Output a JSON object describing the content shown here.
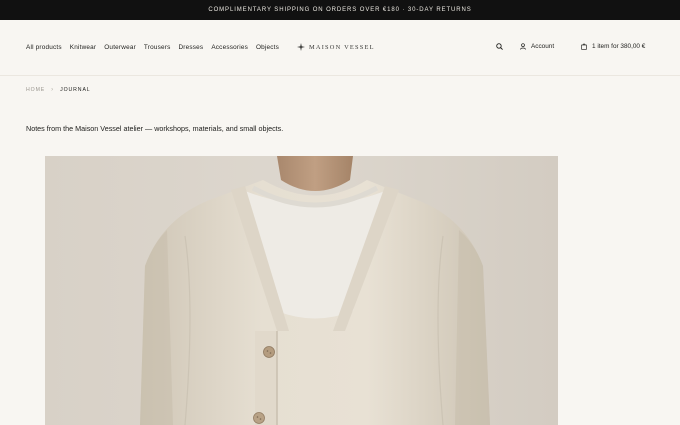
{
  "announcement": "COMPLIMENTARY SHIPPING ON ORDERS OVER €180 · 30-DAY RETURNS",
  "nav": {
    "items": [
      "All products",
      "Knitwear",
      "Outerwear",
      "Trousers",
      "Dresses",
      "Accessories",
      "Objects"
    ]
  },
  "brand": {
    "name": "MAISON VESSEL",
    "icon": "sparkle-icon"
  },
  "header_tools": {
    "search_icon": "search-icon",
    "account_label": "Account",
    "account_icon": "user-icon",
    "cart_label": "1 item for 380,00 €",
    "cart_icon": "bag-icon"
  },
  "breadcrumb": {
    "home": "HOME",
    "separator": "›",
    "current": "JOURNAL"
  },
  "intro": "Notes from the Maison Vessel atelier — workshops, materials, and small objects.",
  "colors": {
    "announcement_bg": "#111111",
    "page_bg": "#f8f6f2",
    "text": "#1d1d1b",
    "muted": "#9a968f"
  }
}
